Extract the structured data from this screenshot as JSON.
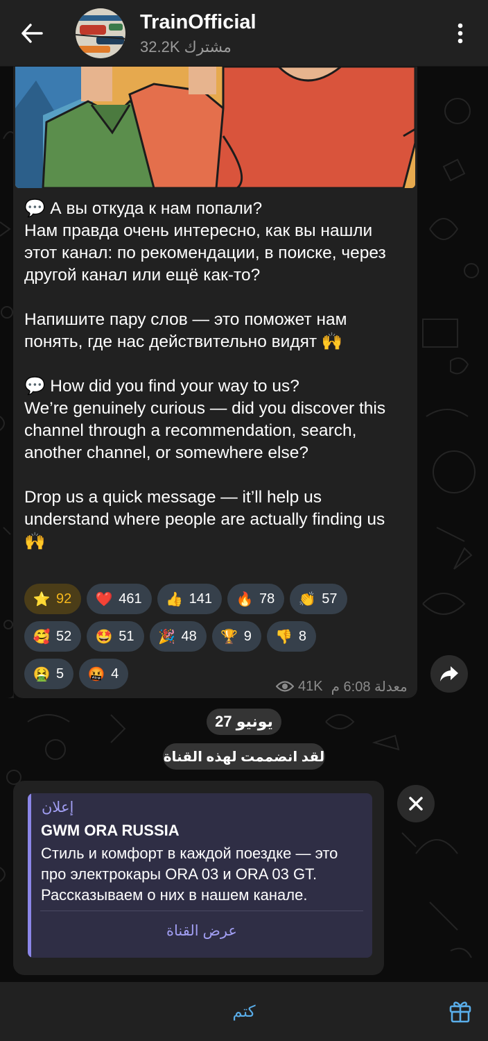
{
  "header": {
    "title": "TrainOfficial",
    "subscribers": "32.2K مشترك"
  },
  "post": {
    "text": "💬 А вы откуда к нам попали?\nНам правда очень интересно, как вы нашли этот канал: по рекомендации, в поиске, через другой канал или ещё как-то?\n\nНапишите пару слов — это поможет нам понять, где нас действительно видят 🙌\n\n💬 How did you find your way to us?\nWe’re genuinely curious — did you discover this channel through a recommendation, search, another channel, or somewhere else?\n\nDrop us a quick message — it’ll help us understand where people are actually finding us 🙌",
    "reactions": [
      {
        "emoji": "⭐",
        "count": "92",
        "style": "gold"
      },
      {
        "emoji": "❤️",
        "count": "461"
      },
      {
        "emoji": "👍",
        "count": "141"
      },
      {
        "emoji": "🔥",
        "count": "78"
      },
      {
        "emoji": "👏",
        "count": "57"
      },
      {
        "emoji": "🥰",
        "count": "52"
      },
      {
        "emoji": "🤩",
        "count": "51"
      },
      {
        "emoji": "🎉",
        "count": "48"
      },
      {
        "emoji": "🏆",
        "count": "9"
      },
      {
        "emoji": "👎",
        "count": "8"
      },
      {
        "emoji": "🤮",
        "count": "5"
      },
      {
        "emoji": "🤬",
        "count": "4"
      }
    ],
    "views": "41K",
    "time": "معدلة 6:08 م"
  },
  "date_separator": "27 يونيو",
  "service_message": "لقد انضممت لهذه القناة",
  "ad": {
    "label": "إعلان",
    "title": "GWM ORA RUSSIA",
    "text": "Стиль и комфорт в каждой поездке — это про электрокары ORA 03 и ORA 03 GT. Рассказываем о них в нашем канале.",
    "action": "عرض القناة"
  },
  "bottom": {
    "mute_label": "كتم"
  },
  "colors": {
    "accent": "#5aaeea",
    "ad_accent": "#a19ef2",
    "bubble": "#212121",
    "gold": "#f5b71c"
  }
}
